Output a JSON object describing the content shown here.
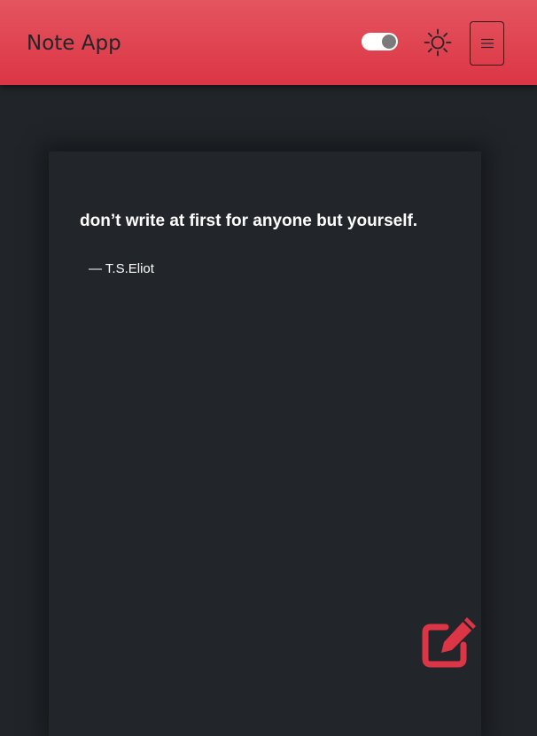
{
  "navbar": {
    "brand": "Note App",
    "theme_toggle": {
      "state": "on"
    },
    "sun_icon": "sun-icon",
    "menu_icon": "hamburger-icon"
  },
  "note": {
    "quote": "don’t write at first for anyone but yourself.",
    "author": "— T.S.Eliot"
  },
  "actions": {
    "edit_icon": "edit-icon"
  },
  "colors": {
    "navbar": "#dc3545",
    "background": "#212428",
    "accent": "#dc3545",
    "text": "#ffffff"
  }
}
